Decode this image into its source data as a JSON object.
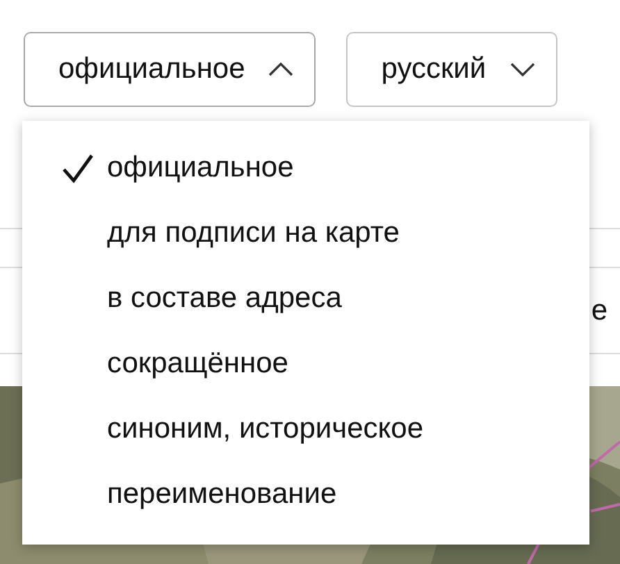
{
  "selects": [
    {
      "value": "официальное",
      "expanded": true
    },
    {
      "value": "русский",
      "expanded": false
    }
  ],
  "menu": {
    "items": [
      {
        "label": "официальное",
        "selected": true
      },
      {
        "label": "для подписи на карте",
        "selected": false
      },
      {
        "label": "в составе адреса",
        "selected": false
      },
      {
        "label": "сокращённое",
        "selected": false
      },
      {
        "label": "синоним, историческое",
        "selected": false
      },
      {
        "label": "переименование",
        "selected": false
      }
    ]
  },
  "background_field": {
    "text": "е"
  }
}
